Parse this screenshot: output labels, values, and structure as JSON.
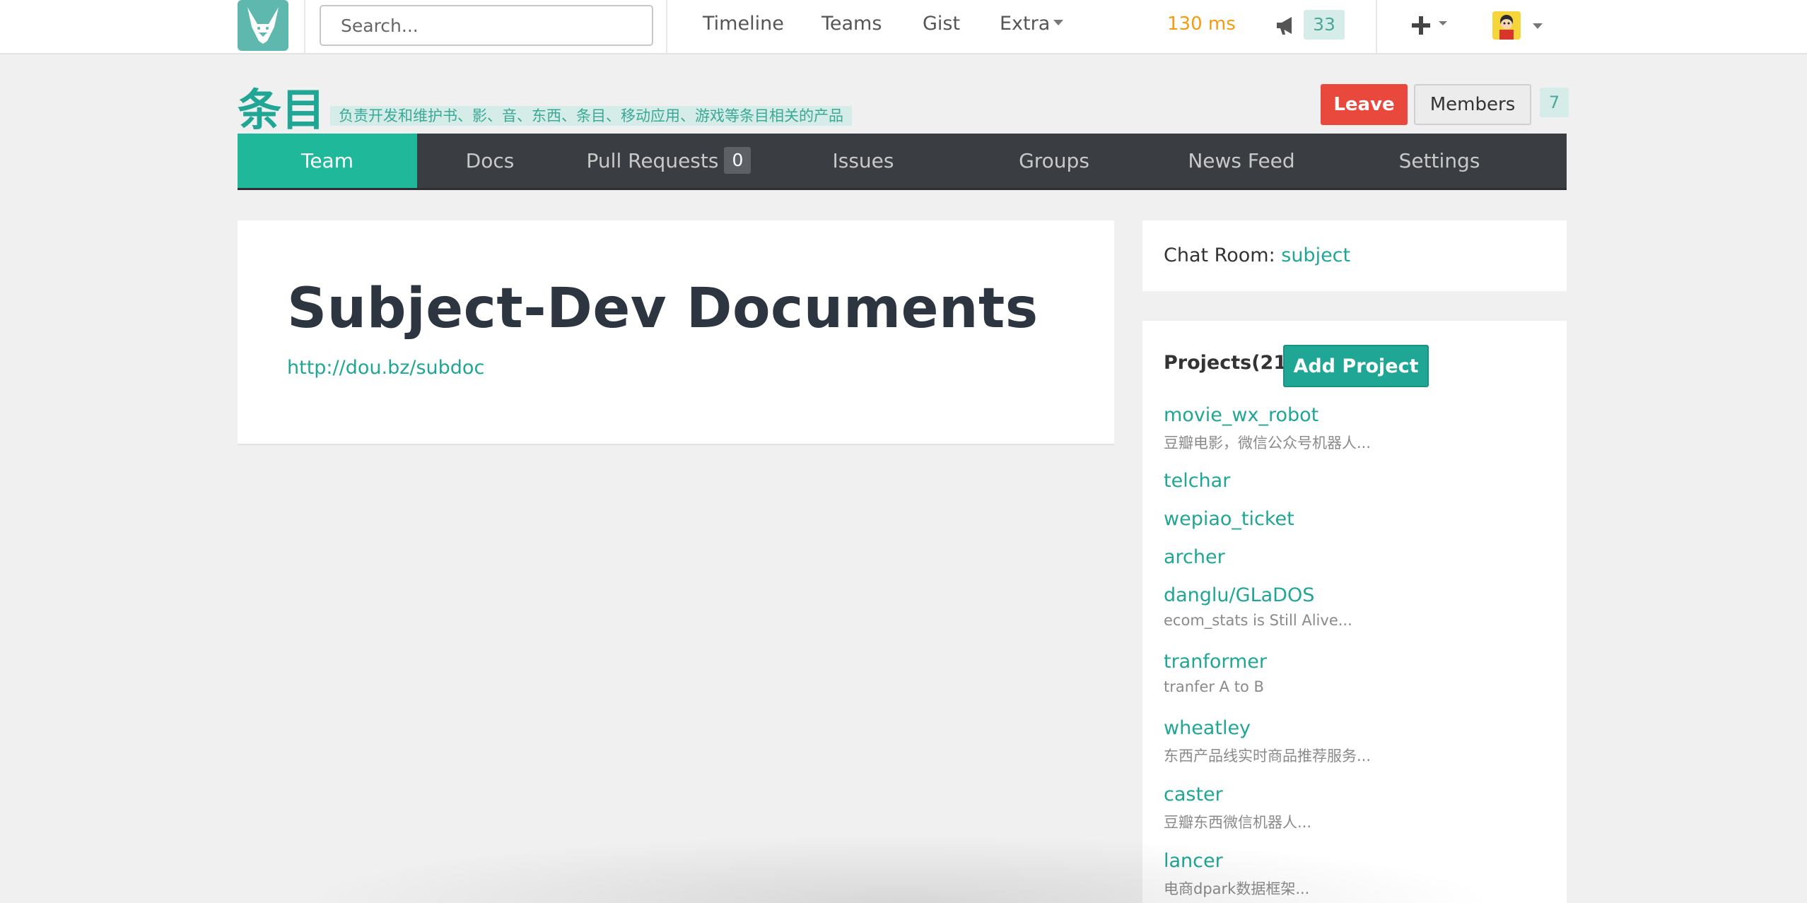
{
  "navbar": {
    "logo_icon": "fox-logo-icon",
    "search_placeholder": "Search...",
    "links": {
      "timeline": "Timeline",
      "teams": "Teams",
      "gist": "Gist",
      "extra": "Extra"
    },
    "timing": "130 ms",
    "notification_icon": "megaphone-icon",
    "notification_count": "33",
    "create_icon": "plus-icon",
    "avatar_icon": "user-avatar"
  },
  "team": {
    "name": "条目",
    "description": "负责开发和维护书、影、音、东西、条目、移动应用、游戏等条目相关的产品",
    "leave_label": "Leave",
    "members_label": "Members",
    "members_count": "7"
  },
  "subnav": {
    "team": "Team",
    "docs": "Docs",
    "pull_requests": "Pull Requests",
    "pull_requests_count": "0",
    "issues": "Issues",
    "groups": "Groups",
    "news_feed": "News Feed",
    "settings": "Settings"
  },
  "doc": {
    "title": "Subject-Dev Documents",
    "link": "http://dou.bz/subdoc"
  },
  "chat": {
    "label": "Chat Room: ",
    "room": "subject"
  },
  "projects": {
    "title": "Projects(21)",
    "add_label": "Add Project",
    "items": [
      {
        "name": "movie_wx_robot",
        "desc": "豆瓣电影，微信公众号机器人..."
      },
      {
        "name": "telchar",
        "desc": ""
      },
      {
        "name": "wepiao_ticket",
        "desc": ""
      },
      {
        "name": "archer",
        "desc": ""
      },
      {
        "name": "danglu/GLaDOS",
        "desc": "ecom_stats is Still Alive..."
      },
      {
        "name": "tranformer",
        "desc": "tranfer A to B"
      },
      {
        "name": "wheatley",
        "desc": "东西产品线实时商品推荐服务..."
      },
      {
        "name": "caster",
        "desc": "豆瓣东西微信机器人..."
      },
      {
        "name": "lancer",
        "desc": "电商dpark数据框架..."
      }
    ]
  },
  "colors": {
    "accent": "#1fa694",
    "active_tab": "#1fb89b",
    "subnav_bg": "#3a3d42",
    "leave": "#e9483c",
    "timing": "#f39c12"
  }
}
